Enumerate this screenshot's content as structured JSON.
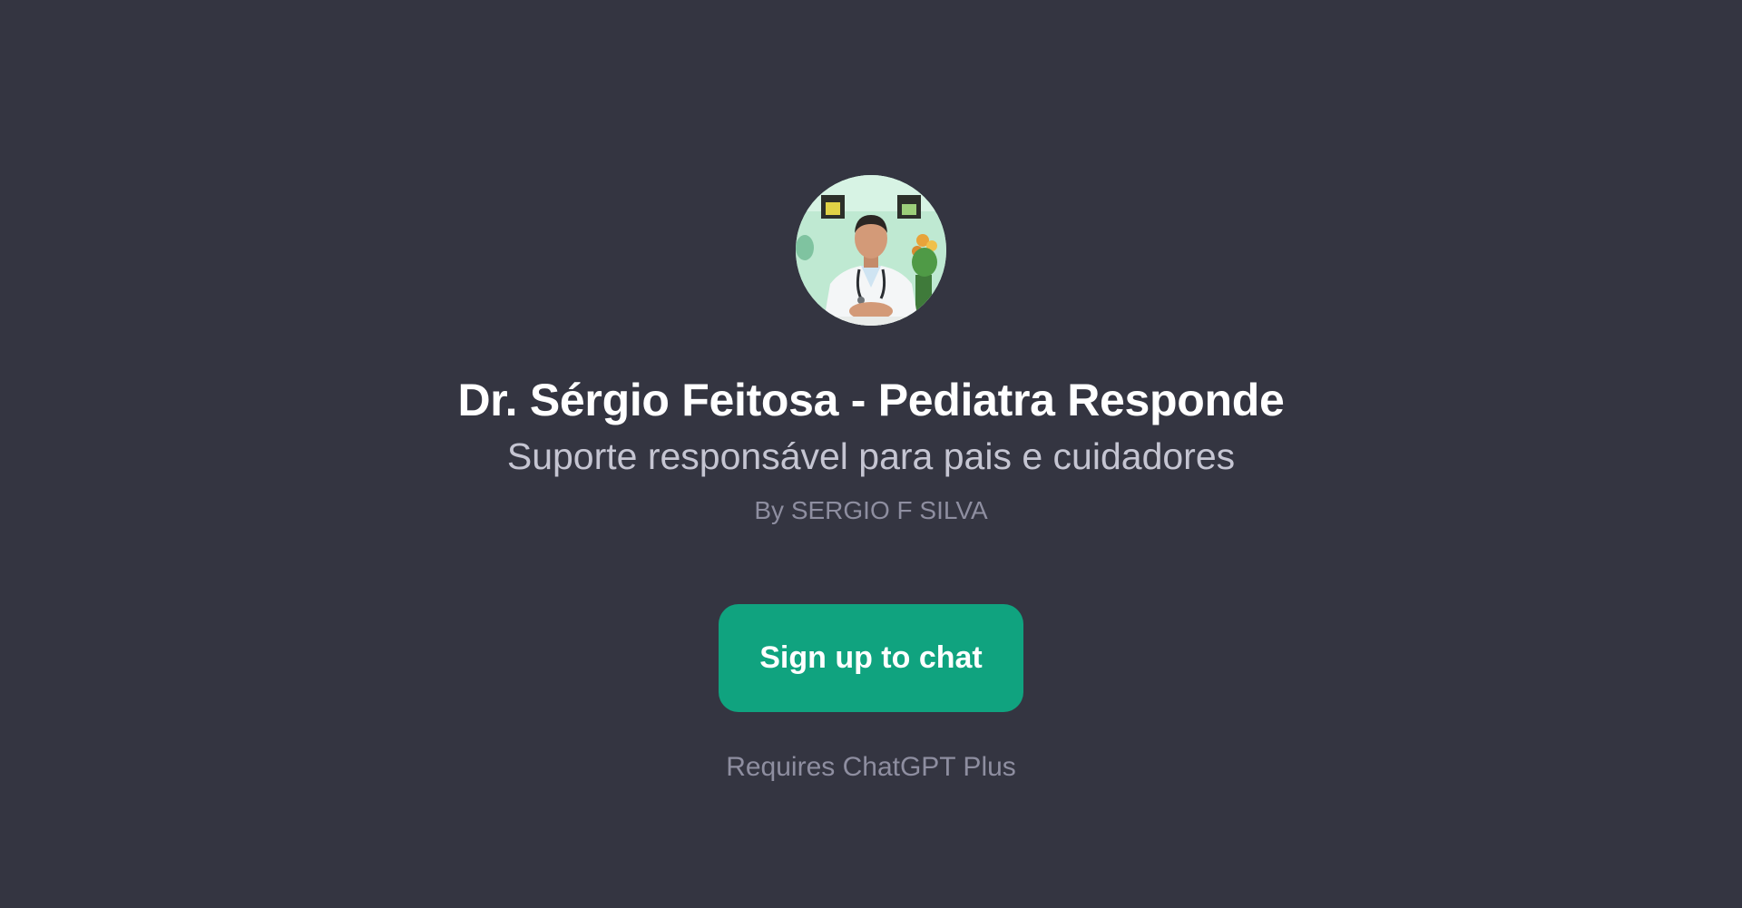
{
  "gpt": {
    "name": "Dr. Sérgio Feitosa - Pediatra Responde",
    "description": "Suporte responsável para pais e cuidadores",
    "author": "By SERGIO F SILVA",
    "avatar_icon": "doctor-portrait"
  },
  "cta": {
    "label": "Sign up to chat",
    "color": "#10a37f"
  },
  "requirement": "Requires ChatGPT Plus",
  "colors": {
    "background": "#343541",
    "title": "#ffffff",
    "subtitle": "#c5c5d2",
    "muted": "#8e8ea0"
  }
}
